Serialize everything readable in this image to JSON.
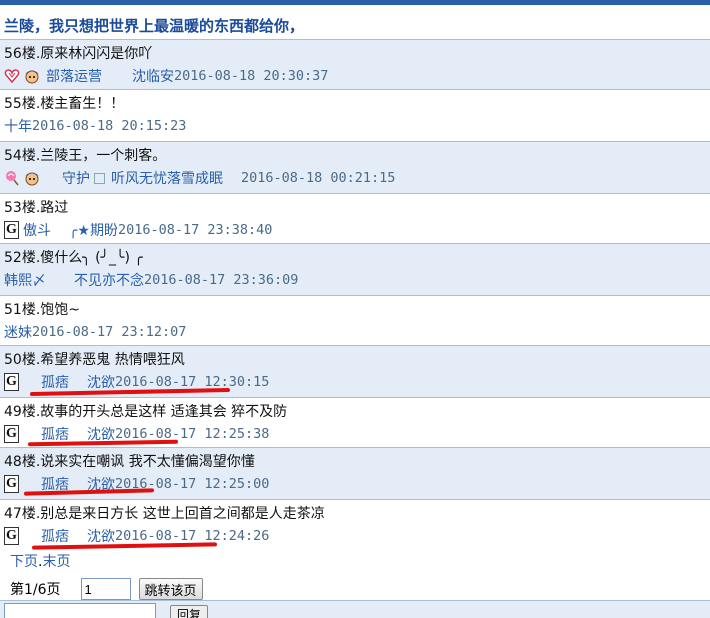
{
  "header": {
    "title": "兰陵，我只想把世界上最温暖的东西都给你，"
  },
  "posts": [
    {
      "floor": "56楼.",
      "text": "原来林闪闪是你吖",
      "user1": "部落运营",
      "user2": "沈临安",
      "time": "2016-08-18 20:30:37"
    },
    {
      "floor": "55楼.",
      "text": "楼主畜生！！",
      "user1": "十年",
      "time": "2016-08-18 20:15:23"
    },
    {
      "floor": "54楼.",
      "text": "兰陵王，一个刺客。",
      "user1": "守护",
      "user2": "听风无忧落雪成眠",
      "time": "2016-08-18 00:21:15"
    },
    {
      "floor": "53楼.",
      "text": "路过",
      "user1": "傲斗",
      "user2": "╭★期盼",
      "time": "2016-08-17 23:38:40"
    },
    {
      "floor": "52楼.",
      "text": "傻什么╮ (╯_╰) ╭",
      "user1": "韩熙〆",
      "user2": "不见亦不念",
      "time": "2016-08-17 23:36:09"
    },
    {
      "floor": "51楼.",
      "text": "饱饱~",
      "user1": "迷妹",
      "time": "2016-08-17 23:12:07"
    },
    {
      "floor": "50楼.",
      "text": "希望养恶鬼 热情喂狂风",
      "user1": "孤痞",
      "user2": "沈欲",
      "time": "2016-08-17 12:30:15"
    },
    {
      "floor": "49楼.",
      "text": "故事的开头总是这样 适逢其会 猝不及防",
      "user1": "孤痞",
      "user2": "沈欲",
      "time": "2016-08-17 12:25:38"
    },
    {
      "floor": "48楼.",
      "text": "说来实在嘲讽 我不太懂偏渴望你懂",
      "user1": "孤痞",
      "user2": "沈欲",
      "time": "2016-08-17 12:25:00"
    },
    {
      "floor": "47楼.",
      "text": "别总是来日方长 这世上回首之间都是人走茶凉",
      "user1": "孤痞",
      "user2": "沈欲",
      "time": "2016-08-17 12:24:26"
    }
  ],
  "pager": {
    "next": "下页",
    "last": "末页",
    "page_info": "第1/6页",
    "page_input_value": "1",
    "jump_label": "跳转该页"
  },
  "reply": {
    "button_label": "回复"
  },
  "colors": {
    "link": "#2a5fab",
    "shade": "#e4edf7",
    "underline": "#e01010"
  }
}
